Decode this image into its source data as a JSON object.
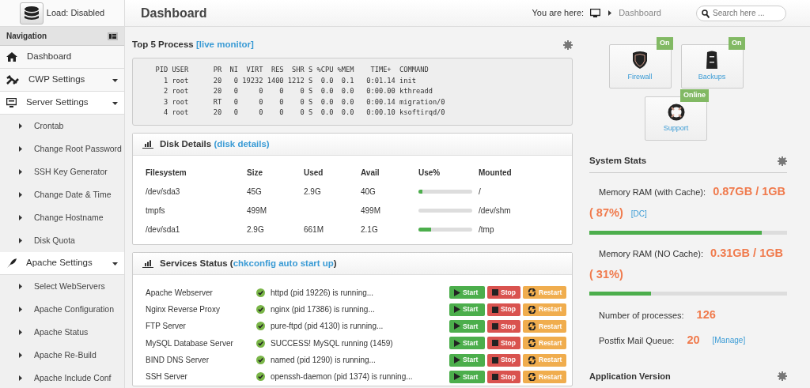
{
  "load_button": {
    "label": "Load: Disabled"
  },
  "navigation": {
    "title": "Navigation",
    "items": [
      {
        "label": "Dashboard",
        "kind": "home",
        "has_caret": false
      },
      {
        "label": "CWP Settings",
        "kind": "tools",
        "expanded": false,
        "has_caret": true
      },
      {
        "label": "Server Settings",
        "kind": "monitor",
        "expanded": true,
        "has_caret": true,
        "children": [
          {
            "label": "Crontab"
          },
          {
            "label": "Change Root Password"
          },
          {
            "label": "SSH Key Generator"
          },
          {
            "label": "Change Date & Time"
          },
          {
            "label": "Change Hostname"
          },
          {
            "label": "Disk Quota"
          }
        ]
      },
      {
        "label": "Apache Settings",
        "kind": "feather",
        "expanded": true,
        "has_caret": true,
        "children": [
          {
            "label": "Select WebServers"
          },
          {
            "label": "Apache Configuration"
          },
          {
            "label": "Apache Status"
          },
          {
            "label": "Apache Re-Build"
          },
          {
            "label": "Apache Include Conf"
          }
        ]
      }
    ]
  },
  "header": {
    "title": "Dashboard",
    "breadcrumb_label": "You are here:",
    "breadcrumb": "Dashboard",
    "search": {
      "placeholder": "Search here ..."
    }
  },
  "process": {
    "title": "Top 5 Process",
    "link": "[live monitor]",
    "lines": [
      "  PID USER      PR  NI  VIRT  RES  SHR S %CPU %MEM    TIME+  COMMAND",
      "    1 root      20   0 19232 1400 1212 S  0.0  0.1   0:01.14 init",
      "    2 root      20   0     0    0    0 S  0.0  0.0   0:00.00 kthreadd",
      "    3 root      RT   0     0    0    0 S  0.0  0.0   0:00.14 migration/0",
      "    4 root      20   0     0    0    0 S  0.0  0.0   0:00.10 ksoftirqd/0"
    ]
  },
  "disk": {
    "title": "Disk Details",
    "link": "(disk details)",
    "columns": [
      "Filesystem",
      "Size",
      "Used",
      "Avail",
      "Use%",
      "Mounted"
    ],
    "rows": [
      {
        "filesystem": "/dev/sda3",
        "size": "45G",
        "used": "2.9G",
        "avail": "40G",
        "level": 0.07,
        "mounted": "/"
      },
      {
        "filesystem": "tmpfs",
        "size": "499M",
        "avail": "499M",
        "level": 0,
        "mounted": "/dev/shm"
      },
      {
        "filesystem": "/dev/sda1",
        "size": "2.9G",
        "used": "661M",
        "avail": "2.1G",
        "level": 0.24,
        "mounted": "/tmp"
      }
    ]
  },
  "services": {
    "title": "Services Status (",
    "link": "chkconfig auto start up",
    "title_close": ")",
    "rows": [
      {
        "name": "Apache Webserver",
        "running": true,
        "status": "httpd (pid 19226) is running...",
        "buttons": [
          "Start",
          "Stop",
          "Restart"
        ]
      },
      {
        "name": "Nginx Reverse Proxy",
        "running": true,
        "status": "nginx (pid 17386) is running...",
        "buttons": [
          "Start",
          "Stop",
          "Restart"
        ]
      },
      {
        "name": "FTP Server",
        "running": true,
        "status": "pure-ftpd (pid 4130) is running...",
        "buttons": [
          "Start",
          "Stop",
          "Restart"
        ]
      },
      {
        "name": "MySQL Database Server",
        "running": true,
        "status": "SUCCESS! MySQL running (1459)",
        "buttons": [
          "Start",
          "Stop",
          "Restart"
        ]
      },
      {
        "name": "BIND DNS Server",
        "running": true,
        "status": "named (pid 1290) is running...",
        "buttons": [
          "Start",
          "Stop",
          "Restart"
        ]
      },
      {
        "name": "SSH Server",
        "running": true,
        "status": "openssh-daemon (pid 1374) is running...",
        "buttons": [
          "Start",
          "Stop",
          "Restart"
        ]
      }
    ]
  },
  "tiles": [
    {
      "label": "Firewall",
      "kind": "shield",
      "badge": "On"
    },
    {
      "label": "Backups",
      "kind": "cabinet",
      "badge": "On"
    },
    {
      "label": "Support",
      "kind": "lifebuoy",
      "badge": "Online"
    }
  ],
  "system_stats": {
    "title": "System Stats",
    "memory": [
      {
        "label": "Memory RAM (with Cache):",
        "value": "0.87GB / 1GB ( 87%)",
        "link": "[DC]",
        "level": 0.87
      },
      {
        "label": "Memory RAM (NO Cache):",
        "value": "0.31GB / 1GB ( 31%)",
        "level": 0.31
      }
    ],
    "counts": [
      {
        "label": "Number of processes:",
        "value": "126"
      },
      {
        "label": "Postfix Mail Queue:",
        "value": "20",
        "link": "[Manage]"
      }
    ]
  },
  "application_version": {
    "title": "Application Version"
  }
}
